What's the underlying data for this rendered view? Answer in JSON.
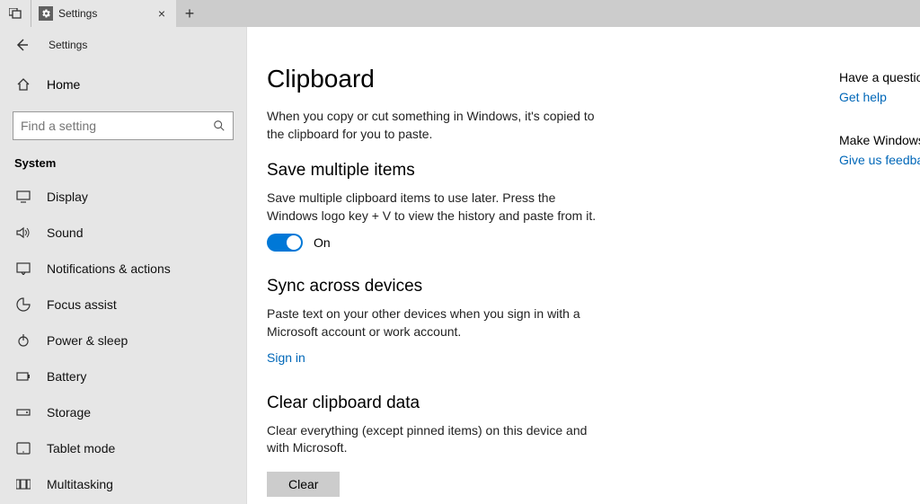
{
  "titlebar": {
    "tab_title": "Settings"
  },
  "header": {
    "title": "Settings"
  },
  "home_label": "Home",
  "search": {
    "placeholder": "Find a setting"
  },
  "section_label": "System",
  "nav": [
    {
      "label": "Display"
    },
    {
      "label": "Sound"
    },
    {
      "label": "Notifications & actions"
    },
    {
      "label": "Focus assist"
    },
    {
      "label": "Power & sleep"
    },
    {
      "label": "Battery"
    },
    {
      "label": "Storage"
    },
    {
      "label": "Tablet mode"
    },
    {
      "label": "Multitasking"
    }
  ],
  "main": {
    "title": "Clipboard",
    "intro": "When you copy or cut something in Windows, it's copied to the clipboard for you to paste.",
    "section1_head": "Save multiple items",
    "section1_desc": "Save multiple clipboard items to use later. Press the Windows logo key + V to view the history and paste from it.",
    "toggle1_state": "On",
    "section2_head": "Sync across devices",
    "section2_desc": "Paste text on your other devices when you sign in with a Microsoft account or work account.",
    "signin_link": "Sign in",
    "section3_head": "Clear clipboard data",
    "section3_desc": "Clear everything (except pinned items) on this device and with Microsoft.",
    "clear_btn": "Clear"
  },
  "help": {
    "q_head": "Have a question?",
    "q_link": "Get help",
    "f_head": "Make Windows better",
    "f_link": "Give us feedback"
  }
}
